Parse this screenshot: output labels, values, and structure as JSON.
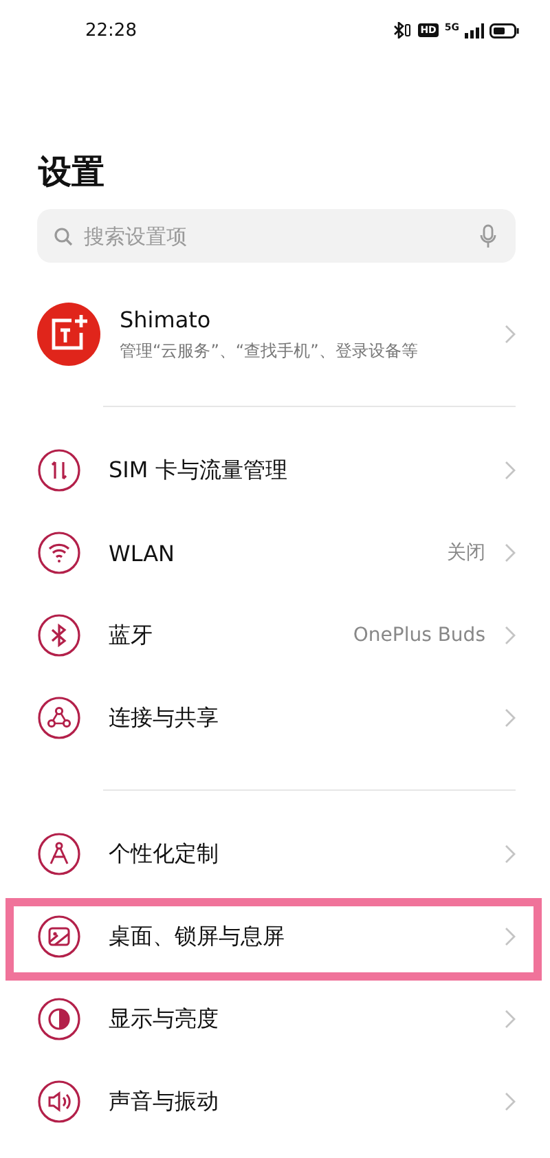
{
  "status_bar": {
    "time": "22:28",
    "hd": "HD",
    "network": "5G"
  },
  "title": "设置",
  "search": {
    "placeholder": "搜索设置项"
  },
  "account": {
    "name": "Shimato",
    "subtitle": "管理“云服务”、“查找手机”、登录设备等"
  },
  "sections": [
    {
      "items": [
        {
          "label": "SIM 卡与流量管理",
          "highlighted": false
        },
        {
          "label": "WLAN",
          "value": "关闭",
          "highlighted": false
        },
        {
          "label": "蓝牙",
          "value": "OnePlus Buds",
          "highlighted": false
        },
        {
          "label": "连接与共享",
          "highlighted": false
        }
      ]
    },
    {
      "items": [
        {
          "label": "个性化定制",
          "highlighted": false
        },
        {
          "label": "桌面、锁屏与息屏",
          "highlighted": true
        },
        {
          "label": "显示与亮度",
          "highlighted": false
        },
        {
          "label": "声音与振动",
          "highlighted": false
        }
      ]
    }
  ]
}
